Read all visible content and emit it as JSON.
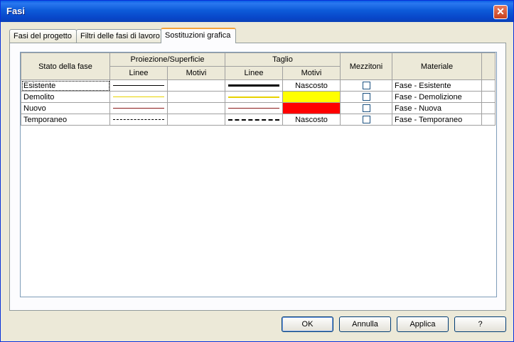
{
  "window": {
    "title": "Fasi",
    "close_glyph": "✕"
  },
  "tabs": [
    {
      "label": "Fasi del progetto"
    },
    {
      "label": "Filtri delle fasi di lavoro"
    },
    {
      "label": "Sostituzioni grafica"
    }
  ],
  "grid": {
    "headers": {
      "stato": "Stato della fase",
      "proiezione": "Proiezione/Superficie",
      "taglio": "Taglio",
      "mezzitoni": "Mezzitoni",
      "materiale": "Materiale",
      "linee": "Linee",
      "motivi": "Motivi"
    },
    "rows": [
      {
        "name": "Esistente",
        "cut_pattern": "Nascosto",
        "material": "Fase - Esistente"
      },
      {
        "name": "Demolito",
        "cut_pattern": "",
        "material": "Fase - Demolizione"
      },
      {
        "name": "Nuovo",
        "cut_pattern": "",
        "material": "Fase - Nuova"
      },
      {
        "name": "Temporaneo",
        "cut_pattern": "Nascosto",
        "material": "Fase - Temporaneo"
      }
    ]
  },
  "buttons": {
    "ok": "OK",
    "cancel": "Annulla",
    "apply": "Applica",
    "help": "?"
  },
  "colors": {
    "demolished_line": "#e8d200",
    "new_line": "#8b1a1a",
    "demolished_fill": "#ffff00",
    "new_fill": "#ff0000"
  }
}
